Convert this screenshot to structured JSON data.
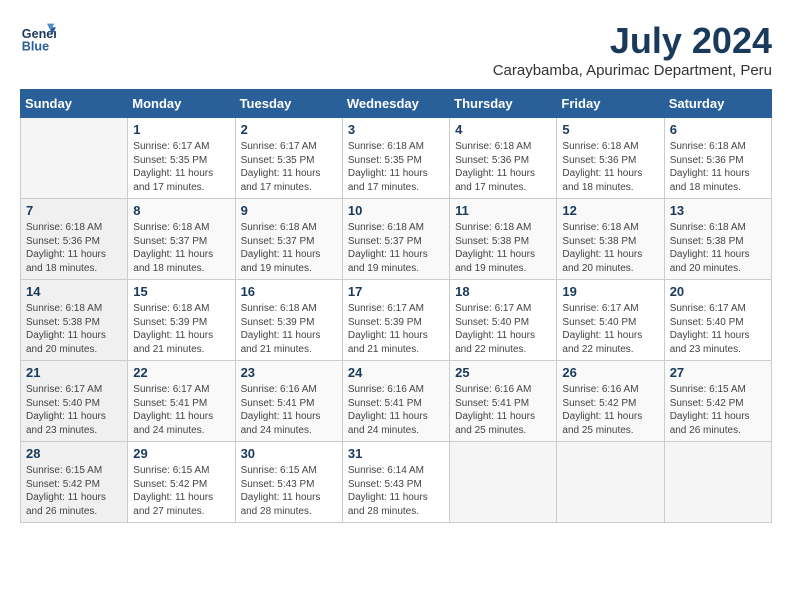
{
  "logo": {
    "line1": "General",
    "line2": "Blue"
  },
  "title": {
    "month_year": "July 2024",
    "location": "Caraybamba, Apurimac Department, Peru"
  },
  "weekdays": [
    "Sunday",
    "Monday",
    "Tuesday",
    "Wednesday",
    "Thursday",
    "Friday",
    "Saturday"
  ],
  "weeks": [
    [
      {
        "num": "",
        "sunrise": "",
        "sunset": "",
        "daylight": ""
      },
      {
        "num": "1",
        "sunrise": "Sunrise: 6:17 AM",
        "sunset": "Sunset: 5:35 PM",
        "daylight": "Daylight: 11 hours and 17 minutes."
      },
      {
        "num": "2",
        "sunrise": "Sunrise: 6:17 AM",
        "sunset": "Sunset: 5:35 PM",
        "daylight": "Daylight: 11 hours and 17 minutes."
      },
      {
        "num": "3",
        "sunrise": "Sunrise: 6:18 AM",
        "sunset": "Sunset: 5:35 PM",
        "daylight": "Daylight: 11 hours and 17 minutes."
      },
      {
        "num": "4",
        "sunrise": "Sunrise: 6:18 AM",
        "sunset": "Sunset: 5:36 PM",
        "daylight": "Daylight: 11 hours and 17 minutes."
      },
      {
        "num": "5",
        "sunrise": "Sunrise: 6:18 AM",
        "sunset": "Sunset: 5:36 PM",
        "daylight": "Daylight: 11 hours and 18 minutes."
      },
      {
        "num": "6",
        "sunrise": "Sunrise: 6:18 AM",
        "sunset": "Sunset: 5:36 PM",
        "daylight": "Daylight: 11 hours and 18 minutes."
      }
    ],
    [
      {
        "num": "7",
        "sunrise": "Sunrise: 6:18 AM",
        "sunset": "Sunset: 5:36 PM",
        "daylight": "Daylight: 11 hours and 18 minutes."
      },
      {
        "num": "8",
        "sunrise": "Sunrise: 6:18 AM",
        "sunset": "Sunset: 5:37 PM",
        "daylight": "Daylight: 11 hours and 18 minutes."
      },
      {
        "num": "9",
        "sunrise": "Sunrise: 6:18 AM",
        "sunset": "Sunset: 5:37 PM",
        "daylight": "Daylight: 11 hours and 19 minutes."
      },
      {
        "num": "10",
        "sunrise": "Sunrise: 6:18 AM",
        "sunset": "Sunset: 5:37 PM",
        "daylight": "Daylight: 11 hours and 19 minutes."
      },
      {
        "num": "11",
        "sunrise": "Sunrise: 6:18 AM",
        "sunset": "Sunset: 5:38 PM",
        "daylight": "Daylight: 11 hours and 19 minutes."
      },
      {
        "num": "12",
        "sunrise": "Sunrise: 6:18 AM",
        "sunset": "Sunset: 5:38 PM",
        "daylight": "Daylight: 11 hours and 20 minutes."
      },
      {
        "num": "13",
        "sunrise": "Sunrise: 6:18 AM",
        "sunset": "Sunset: 5:38 PM",
        "daylight": "Daylight: 11 hours and 20 minutes."
      }
    ],
    [
      {
        "num": "14",
        "sunrise": "Sunrise: 6:18 AM",
        "sunset": "Sunset: 5:38 PM",
        "daylight": "Daylight: 11 hours and 20 minutes."
      },
      {
        "num": "15",
        "sunrise": "Sunrise: 6:18 AM",
        "sunset": "Sunset: 5:39 PM",
        "daylight": "Daylight: 11 hours and 21 minutes."
      },
      {
        "num": "16",
        "sunrise": "Sunrise: 6:18 AM",
        "sunset": "Sunset: 5:39 PM",
        "daylight": "Daylight: 11 hours and 21 minutes."
      },
      {
        "num": "17",
        "sunrise": "Sunrise: 6:17 AM",
        "sunset": "Sunset: 5:39 PM",
        "daylight": "Daylight: 11 hours and 21 minutes."
      },
      {
        "num": "18",
        "sunrise": "Sunrise: 6:17 AM",
        "sunset": "Sunset: 5:40 PM",
        "daylight": "Daylight: 11 hours and 22 minutes."
      },
      {
        "num": "19",
        "sunrise": "Sunrise: 6:17 AM",
        "sunset": "Sunset: 5:40 PM",
        "daylight": "Daylight: 11 hours and 22 minutes."
      },
      {
        "num": "20",
        "sunrise": "Sunrise: 6:17 AM",
        "sunset": "Sunset: 5:40 PM",
        "daylight": "Daylight: 11 hours and 23 minutes."
      }
    ],
    [
      {
        "num": "21",
        "sunrise": "Sunrise: 6:17 AM",
        "sunset": "Sunset: 5:40 PM",
        "daylight": "Daylight: 11 hours and 23 minutes."
      },
      {
        "num": "22",
        "sunrise": "Sunrise: 6:17 AM",
        "sunset": "Sunset: 5:41 PM",
        "daylight": "Daylight: 11 hours and 24 minutes."
      },
      {
        "num": "23",
        "sunrise": "Sunrise: 6:16 AM",
        "sunset": "Sunset: 5:41 PM",
        "daylight": "Daylight: 11 hours and 24 minutes."
      },
      {
        "num": "24",
        "sunrise": "Sunrise: 6:16 AM",
        "sunset": "Sunset: 5:41 PM",
        "daylight": "Daylight: 11 hours and 24 minutes."
      },
      {
        "num": "25",
        "sunrise": "Sunrise: 6:16 AM",
        "sunset": "Sunset: 5:41 PM",
        "daylight": "Daylight: 11 hours and 25 minutes."
      },
      {
        "num": "26",
        "sunrise": "Sunrise: 6:16 AM",
        "sunset": "Sunset: 5:42 PM",
        "daylight": "Daylight: 11 hours and 25 minutes."
      },
      {
        "num": "27",
        "sunrise": "Sunrise: 6:15 AM",
        "sunset": "Sunset: 5:42 PM",
        "daylight": "Daylight: 11 hours and 26 minutes."
      }
    ],
    [
      {
        "num": "28",
        "sunrise": "Sunrise: 6:15 AM",
        "sunset": "Sunset: 5:42 PM",
        "daylight": "Daylight: 11 hours and 26 minutes."
      },
      {
        "num": "29",
        "sunrise": "Sunrise: 6:15 AM",
        "sunset": "Sunset: 5:42 PM",
        "daylight": "Daylight: 11 hours and 27 minutes."
      },
      {
        "num": "30",
        "sunrise": "Sunrise: 6:15 AM",
        "sunset": "Sunset: 5:43 PM",
        "daylight": "Daylight: 11 hours and 28 minutes."
      },
      {
        "num": "31",
        "sunrise": "Sunrise: 6:14 AM",
        "sunset": "Sunset: 5:43 PM",
        "daylight": "Daylight: 11 hours and 28 minutes."
      },
      {
        "num": "",
        "sunrise": "",
        "sunset": "",
        "daylight": ""
      },
      {
        "num": "",
        "sunrise": "",
        "sunset": "",
        "daylight": ""
      },
      {
        "num": "",
        "sunrise": "",
        "sunset": "",
        "daylight": ""
      }
    ]
  ]
}
